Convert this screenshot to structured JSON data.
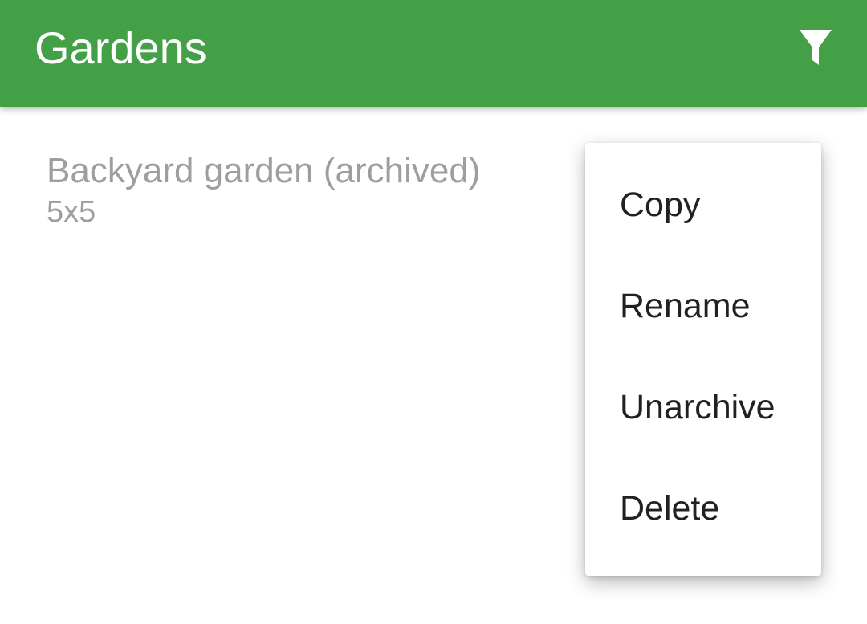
{
  "toolbar": {
    "title": "Gardens",
    "filter_icon": "filter-icon",
    "background_color": "#43a047"
  },
  "gardens": [
    {
      "title": "Backyard garden (archived)",
      "subtitle": "5x5"
    }
  ],
  "popup_menu": {
    "items": [
      {
        "label": "Copy"
      },
      {
        "label": "Rename"
      },
      {
        "label": "Unarchive"
      },
      {
        "label": "Delete"
      }
    ]
  }
}
